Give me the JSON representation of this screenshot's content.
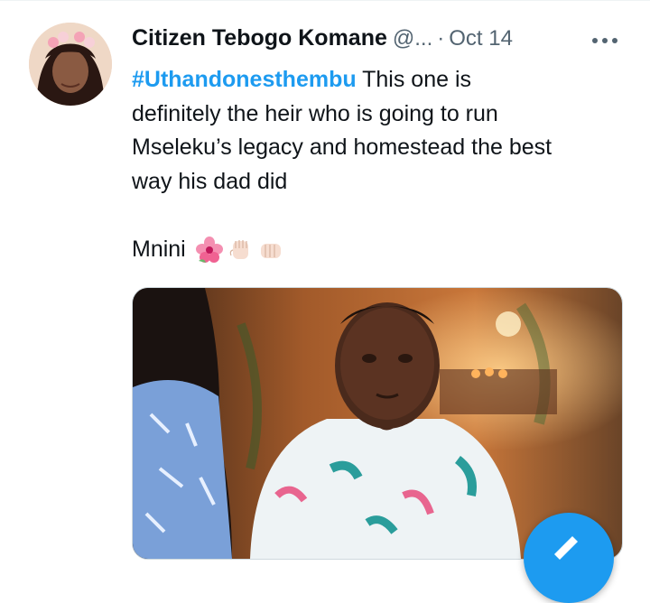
{
  "tweet": {
    "author": {
      "display_name": "Citizen Tebogo Komane",
      "handle": "@...",
      "separator": "·",
      "date": "Oct 14"
    },
    "text": {
      "hashtag": "#Uthandonesthembu",
      "body_line1": " This one is",
      "body_line2": "definitely the heir who is going to run",
      "body_line3": "Mseleku’s legacy and homestead the best",
      "body_line4": "way his dad did",
      "closing": "Mnini"
    },
    "emojis": [
      "hibiscus-icon",
      "raised-fist-icon",
      "oncoming-fist-icon"
    ],
    "more_icon": "more-horizontal-icon"
  },
  "colors": {
    "accent": "#1d9bf0",
    "text_primary": "#0f1419",
    "text_secondary": "#536471"
  }
}
